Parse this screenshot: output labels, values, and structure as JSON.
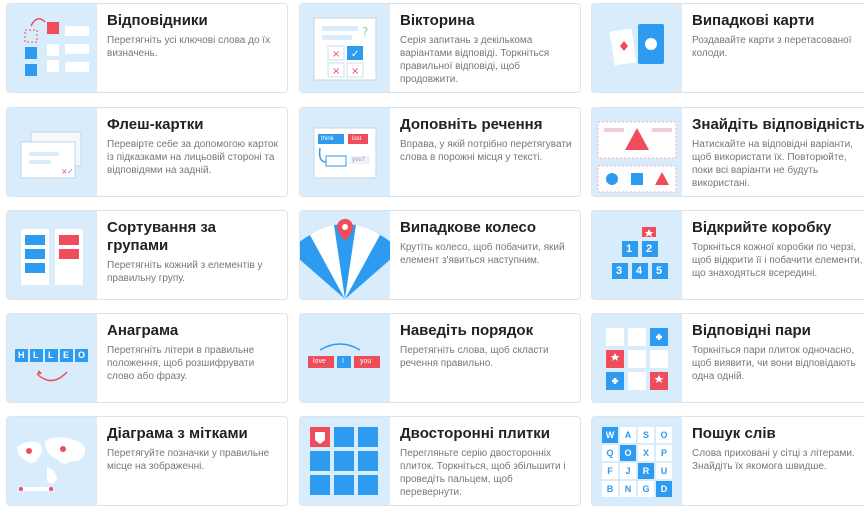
{
  "cards": [
    {
      "title": "Відповідники",
      "desc": "Перетягніть усі ключові слова до їх визначень.",
      "icon": "match-up-icon"
    },
    {
      "title": "Вікторина",
      "desc": "Серія запитань з декількома варіантами відповіді. Торкніться правильної відповіді, щоб продовжити.",
      "icon": "quiz-icon"
    },
    {
      "title": "Випадкові карти",
      "desc": "Роздавайте карти з перетасованої колоди.",
      "icon": "random-cards-icon"
    },
    {
      "title": "Флеш-картки",
      "desc": "Перевірте себе за допомогою карток із підказками на лицьовій стороні та відповідями на задній.",
      "icon": "flash-cards-icon"
    },
    {
      "title": "Доповніть речення",
      "desc": "Вправа, у якій потрібно перетягувати слова в порожні місця у тексті.",
      "icon": "complete-sentence-icon"
    },
    {
      "title": "Знайдіть відповідність",
      "desc": "Натискайте на відповідні варіанти, щоб використати їх. Повторюйте, поки всі варіанти не будуть використані.",
      "icon": "find-match-icon"
    },
    {
      "title": "Сортування за групами",
      "desc": "Перетягніть кожний з елементів у правильну групу.",
      "icon": "group-sort-icon"
    },
    {
      "title": "Випадкове колесо",
      "desc": "Крутіть колесо, щоб побачити, який елемент з'явиться наступним.",
      "icon": "spin-wheel-icon"
    },
    {
      "title": "Відкрийте коробку",
      "desc": "Торкніться кожної коробки по черзі, щоб відкрити її і побачити елементи, що знаходяться всередині.",
      "icon": "open-box-icon"
    },
    {
      "title": "Анаграма",
      "desc": "Перетягніть літери в правильне положення, щоб розшифрувати слово або фразу.",
      "icon": "anagram-icon"
    },
    {
      "title": "Наведіть порядок",
      "desc": "Перетягніть слова, щоб скласти речення правильно.",
      "icon": "unjumble-icon"
    },
    {
      "title": "Відповідні пари",
      "desc": "Торкніться пари плиток одночасно, щоб виявити, чи вони відповідають одна одній.",
      "icon": "matching-pairs-icon"
    },
    {
      "title": "Діаграма з мітками",
      "desc": "Перетягуйте позначки у правильне місце на зображенні.",
      "icon": "labelled-diagram-icon"
    },
    {
      "title": "Двосторонні плитки",
      "desc": "Перегляньте серію двосторонніх плиток. Торкніться, щоб збільшити і проведіть пальцем, щоб перевернути.",
      "icon": "flip-tiles-icon"
    },
    {
      "title": "Пошук слів",
      "desc": "Слова приховані у сітці з літерами. Знайдіть їх якомога швидше.",
      "icon": "wordsearch-icon"
    }
  ],
  "thumb_text": {
    "anagram_letters": [
      "H",
      "L",
      "L",
      "E",
      "O"
    ],
    "unjumble_words": [
      "love",
      "I",
      "you"
    ],
    "fill_words": [
      "think",
      "lost",
      "you?"
    ],
    "box_numbers": [
      "1",
      "2",
      "3",
      "4",
      "5"
    ],
    "wordsearch_letters": [
      "W",
      "A",
      "S",
      "O",
      "Q",
      "O",
      "X",
      "P",
      "F",
      "J",
      "R",
      "U",
      "B",
      "N",
      "G",
      "D"
    ]
  },
  "colors": {
    "thumb_bg": "#d8ecfb",
    "blue": "#2d9bf0",
    "red": "#ef4d5c",
    "title": "#222222",
    "desc": "#777777"
  }
}
